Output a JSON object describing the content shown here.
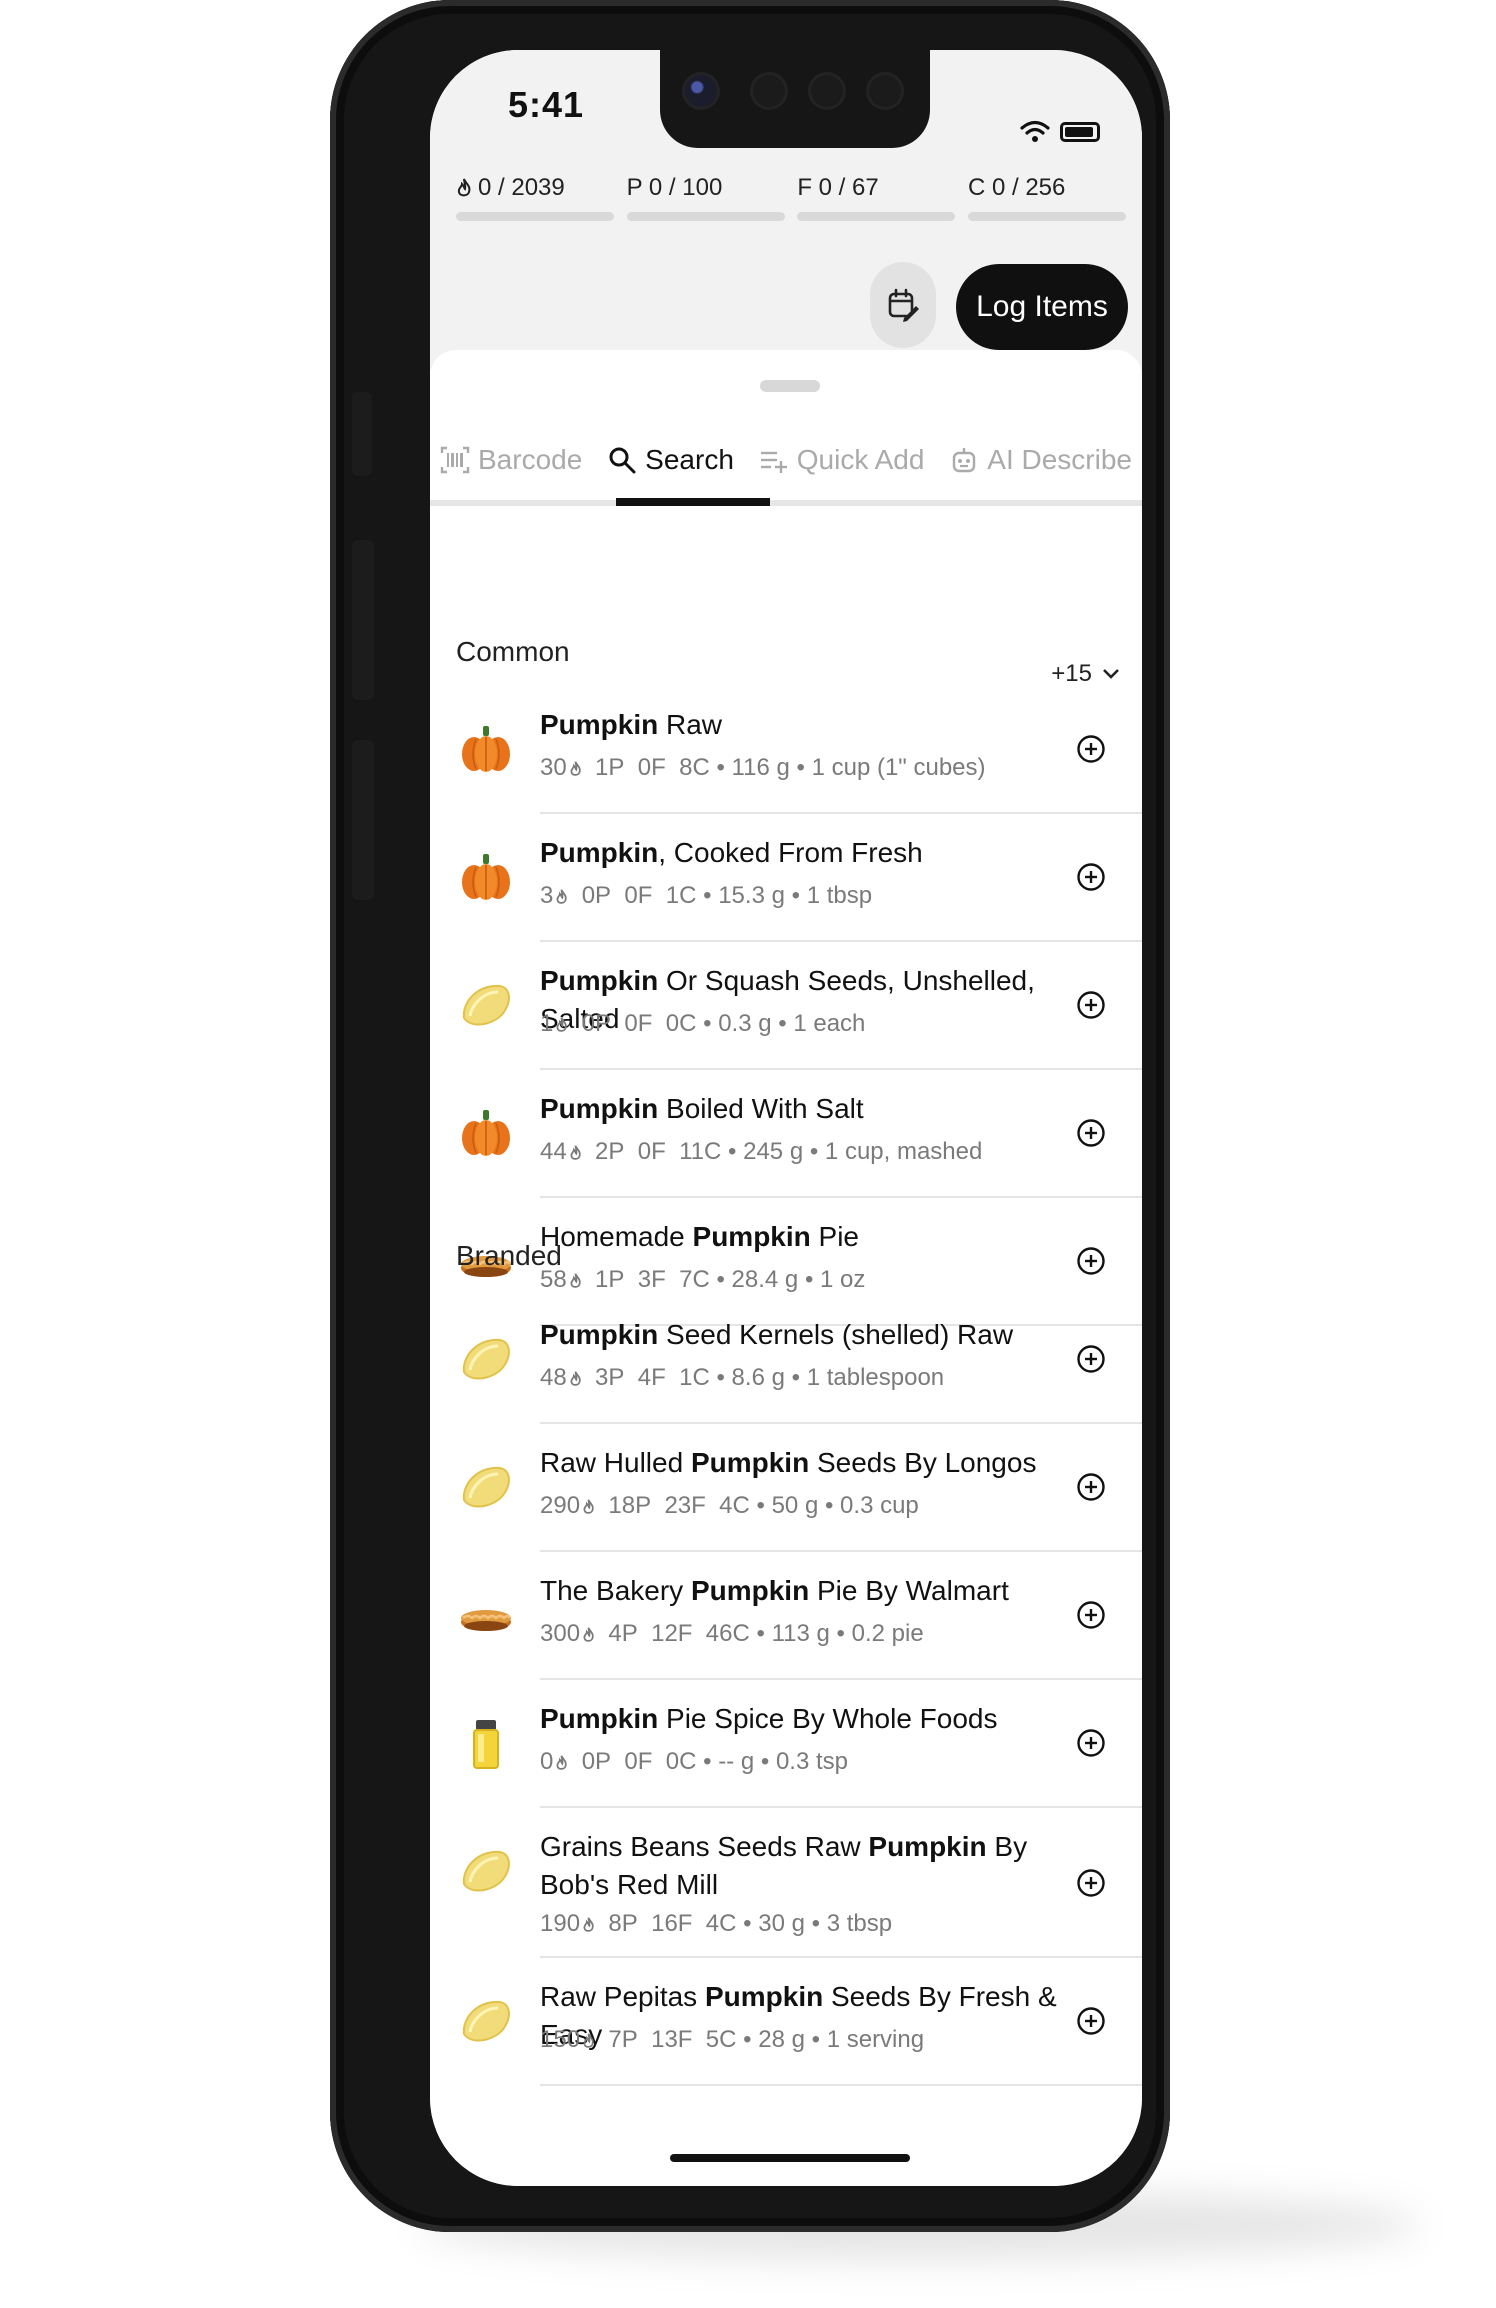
{
  "status": {
    "time": "5:41"
  },
  "macros": [
    {
      "key": "calories",
      "label": "0 / 2039"
    },
    {
      "key": "protein",
      "label": "P 0 / 100"
    },
    {
      "key": "fat",
      "label": "F 0 / 67"
    },
    {
      "key": "carbs",
      "label": "C 0 / 256"
    }
  ],
  "actions": {
    "log_label": "Log Items"
  },
  "tabs": [
    {
      "label": "Barcode",
      "icon": "barcode-icon",
      "active": false
    },
    {
      "label": "Search",
      "icon": "search-icon",
      "active": true
    },
    {
      "label": "Quick Add",
      "icon": "quick-add-icon",
      "active": false
    },
    {
      "label": "AI Describe",
      "icon": "robot-icon",
      "active": false
    }
  ],
  "common": {
    "title": "Common",
    "more": "+15",
    "items": [
      {
        "icon": "pumpkin",
        "name_bold": "Pumpkin",
        "name_rest": " Raw",
        "cal": "30",
        "p": "1P",
        "f": "0F",
        "c": "8C",
        "weight": "116 g",
        "serving": "1 cup (1\" cubes)"
      },
      {
        "icon": "pumpkin",
        "name_bold": "Pumpkin",
        "name_rest": ", Cooked From Fresh",
        "cal": "3",
        "p": "0P",
        "f": "0F",
        "c": "1C",
        "weight": "15.3 g",
        "serving": "1 tbsp"
      },
      {
        "icon": "seed",
        "name_bold": "Pumpkin",
        "name_rest": " Or Squash Seeds, Unshelled, Salted",
        "cal": "1",
        "p": "0P",
        "f": "0F",
        "c": "0C",
        "weight": "0.3 g",
        "serving": "1 each"
      },
      {
        "icon": "pumpkin",
        "name_bold": "Pumpkin",
        "name_rest": " Boiled With Salt",
        "cal": "44",
        "p": "2P",
        "f": "0F",
        "c": "11C",
        "weight": "245 g",
        "serving": "1 cup, mashed"
      },
      {
        "icon": "pie",
        "name_pre": "Homemade ",
        "name_bold": "Pumpkin",
        "name_rest": " Pie",
        "cal": "58",
        "p": "1P",
        "f": "3F",
        "c": "7C",
        "weight": "28.4 g",
        "serving": "1 oz"
      }
    ]
  },
  "branded": {
    "title": "Branded",
    "items": [
      {
        "icon": "seed",
        "name_pre": "",
        "name_bold": "Pumpkin",
        "name_rest": " Seed Kernels (shelled) Raw",
        "cal": "48",
        "p": "3P",
        "f": "4F",
        "c": "1C",
        "weight": "8.6 g",
        "serving": "1 tablespoon"
      },
      {
        "icon": "seed",
        "name_pre": "Raw Hulled ",
        "name_bold": "Pumpkin",
        "name_rest": " Seeds By Longos",
        "cal": "290",
        "p": "18P",
        "f": "23F",
        "c": "4C",
        "weight": "50 g",
        "serving": "0.3 cup"
      },
      {
        "icon": "pie",
        "name_pre": "The Bakery ",
        "name_bold": "Pumpkin",
        "name_rest": " Pie By Walmart",
        "cal": "300",
        "p": "4P",
        "f": "12F",
        "c": "46C",
        "weight": "113 g",
        "serving": "0.2 pie"
      },
      {
        "icon": "spice",
        "name_pre": "",
        "name_bold": "Pumpkin",
        "name_rest": " Pie Spice By Whole Foods",
        "cal": "0",
        "p": "0P",
        "f": "0F",
        "c": "0C",
        "weight": "-- g",
        "serving": "0.3 tsp"
      },
      {
        "icon": "seed",
        "name_pre": "Grains Beans Seeds Raw ",
        "name_bold": "Pumpkin",
        "name_rest": " By Bob's Red Mill",
        "cal": "190",
        "p": "8P",
        "f": "16F",
        "c": "4C",
        "weight": "30 g",
        "serving": "3 tbsp"
      },
      {
        "icon": "seed",
        "name_pre": "Raw Pepitas ",
        "name_bold": "Pumpkin",
        "name_rest": " Seeds By Fresh & Easy",
        "cal": "150",
        "p": "7P",
        "f": "13F",
        "c": "5C",
        "weight": "28 g",
        "serving": "1 serving"
      }
    ]
  }
}
